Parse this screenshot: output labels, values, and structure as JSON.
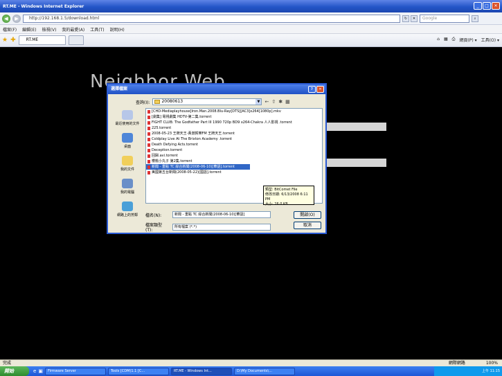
{
  "window": {
    "title": "RT.ME - Windows Internet Explorer"
  },
  "address": {
    "url": "http://192.168.1.5/download.html",
    "search_placeholder": "Google"
  },
  "menu": [
    "檔案(F)",
    "編輯(E)",
    "檢視(V)",
    "我的最愛(A)",
    "工具(T)",
    "說明(H)"
  ],
  "tabs": {
    "active_label": "RT.ME"
  },
  "commands": [
    "網頁(P) ▾",
    "工具(O) ▾"
  ],
  "page": {
    "logo_text": "Neighbor Web"
  },
  "dialog": {
    "title": "選擇檔案",
    "lookin_label": "查詢(I):",
    "lookin_value": "20080613",
    "places": [
      "最近使用的文件",
      "桌面",
      "我的文件",
      "我的電腦",
      "網路上的芳鄰"
    ],
    "files": [
      "[CHD-Mediaplayhouse]Iron.Man.2008.Blu-Ray[DTS][AC3]x264[1080p].mkv",
      "[劇集] 電視劇集 HDTV-第二集.torrent",
      "FIGHT CLUB: The Godfather Part III 1990 720p BD9 x264-Chakra 人人影視 .torrent",
      "225.torrent",
      "2008-05-23 王牌天王-黃渤賀樂FM 王牌天王.torrent",
      "Coldplay Live At The Brixton Academy .torrent",
      "Death Defying Acts.torrent",
      "Deception.torrent",
      "回歸.avi.torrent",
      "櫻桃小丸子 第2集.torrent",
      "新聞 - 重點 TC 綜合新聞(2008-06-10)[華語].torrent",
      "美國第五台新聞(2008-05-22)[國語].torrent"
    ],
    "selected_index": 10,
    "tooltip": [
      "類型: BitComet File",
      "修改日期: 6/13/2008 6:11 PM",
      "大小: 26.0 KB"
    ],
    "filename_label": "檔名(N):",
    "filename_value": "新聞 - 重點 TC 綜合新聞(2008-06-10)[華語]",
    "filetype_label": "檔案類型(T):",
    "filetype_value": "所有檔案 (*.*)",
    "open_label": "開啟(O)",
    "cancel_label": "取消"
  },
  "status": {
    "left": "完成",
    "zone": "網際網路",
    "zoom": "100%"
  },
  "taskbar": {
    "start": "開始",
    "tasks": [
      "Firmware Server",
      "Tools [CDM(1.1 [C...",
      "RT.ME - Windows Int...",
      "D:\\My Documents\\..."
    ],
    "tray_time": "上午 11:15"
  }
}
